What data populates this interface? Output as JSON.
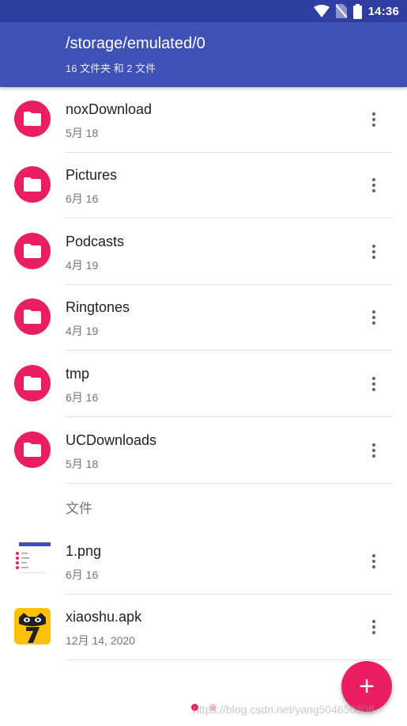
{
  "status_bar": {
    "time": "14:36"
  },
  "header": {
    "path": "/storage/emulated/0",
    "summary": "16 文件夹 和 2 文件"
  },
  "folders": [
    {
      "name": "noxDownload",
      "date": "5月 18"
    },
    {
      "name": "Pictures",
      "date": "6月 16"
    },
    {
      "name": "Podcasts",
      "date": "4月 19"
    },
    {
      "name": "Ringtones",
      "date": "4月 19"
    },
    {
      "name": "tmp",
      "date": "6月 16"
    },
    {
      "name": "UCDownloads",
      "date": "5月 18"
    }
  ],
  "files_section": {
    "label": "文件"
  },
  "files": [
    {
      "name": "1.png",
      "date": "6月 16"
    },
    {
      "name": "xiaoshu.apk",
      "date": "12月 14, 2020"
    }
  ],
  "fab": {
    "label": "+"
  },
  "watermark": "https://blog.csdn.net/yang504650308",
  "colors": {
    "primary": "#3f51b5",
    "primary_dark": "#303f9f",
    "accent": "#e91e63",
    "apk_icon": "#ffc107"
  },
  "icons": {
    "status": [
      "wifi-icon",
      "no-sim-icon",
      "battery-icon"
    ],
    "folder": "folder-icon",
    "overflow": "more-vert-icon"
  }
}
